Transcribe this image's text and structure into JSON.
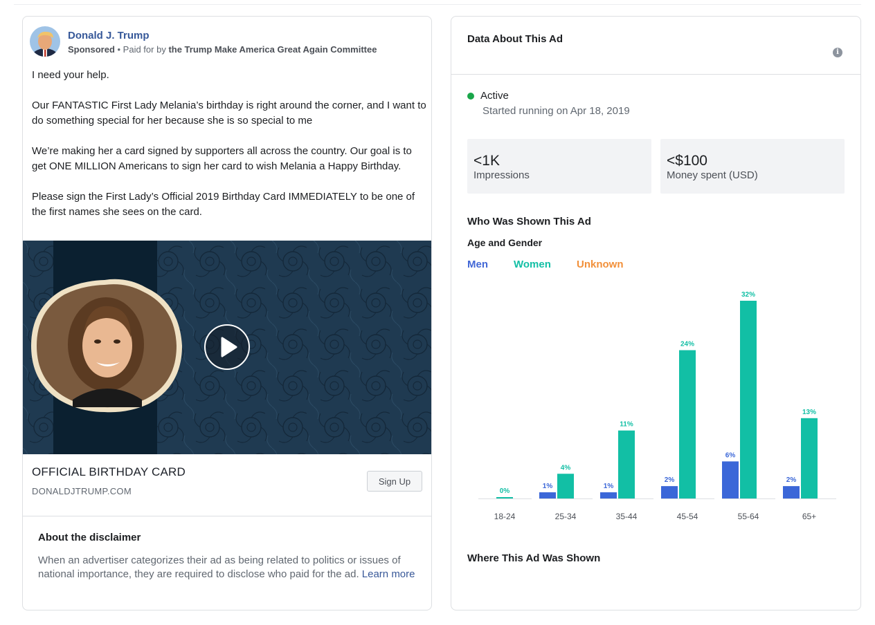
{
  "ad": {
    "advertiser_name": "Donald J. Trump",
    "sponsored_label": "Sponsored",
    "paid_for_prefix": " • Paid for by ",
    "paid_for_by": "the Trump Make America Great Again Committee",
    "body": [
      "I need your help.",
      "Our FANTASTIC First Lady Melania’s birthday is right around the corner, and I want to do something special for her because she is so special to me",
      "We’re making her a card signed by supporters all across the country. Our goal is to get ONE MILLION Americans to sign her card to wish Melania a Happy Birthday.",
      "Please sign the First Lady’s Official 2019 Birthday Card IMMEDIATELY to be one of the first names she sees on the card."
    ],
    "link_title": "OFFICIAL BIRTHDAY CARD",
    "link_domain": "DONALDJTRUMP.COM",
    "cta_label": "Sign Up",
    "media_icon": "play-icon"
  },
  "disclaimer": {
    "title": "About the disclaimer",
    "text": "When an advertiser categorizes their ad as being related to politics or issues of national importance, they are required to disclose who paid for the ad. ",
    "link": "Learn more"
  },
  "data_panel": {
    "title": "Data About This Ad",
    "info_icon": "info-icon",
    "status": "Active",
    "status_color": "#1aa64a",
    "started": "Started running on Apr 18, 2019",
    "impressions_value": "<1K",
    "impressions_label": "Impressions",
    "spend_value": "<$100",
    "spend_label": "Money spent (USD)",
    "shown_title": "Who Was Shown This Ad",
    "age_gender_title": "Age and Gender",
    "legend": [
      {
        "label": "Men",
        "color": "#4267d6"
      },
      {
        "label": "Women",
        "color": "#12bfa5"
      },
      {
        "label": "Unknown",
        "color": "#f2903a"
      }
    ],
    "where_title": "Where This Ad Was Shown"
  },
  "chart_data": {
    "type": "bar",
    "categories": [
      "18-24",
      "25-34",
      "35-44",
      "45-54",
      "55-64",
      "65+"
    ],
    "series": [
      {
        "name": "Men",
        "values": [
          null,
          1,
          1,
          2,
          6,
          2
        ],
        "labels": [
          "",
          "1%",
          "1%",
          "2%",
          "6%",
          "2%"
        ],
        "color": "#3b67d8"
      },
      {
        "name": "Women",
        "values": [
          0,
          4,
          11,
          24,
          32,
          13
        ],
        "labels": [
          "0%",
          "4%",
          "11%",
          "24%",
          "32%",
          "13%"
        ],
        "color": "#12bfa5"
      }
    ],
    "ylim": [
      0,
      32
    ]
  }
}
